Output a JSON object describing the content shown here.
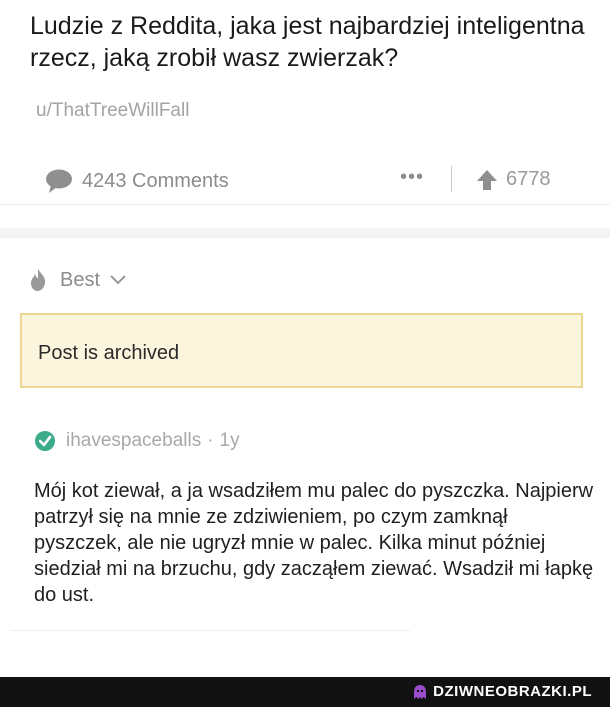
{
  "post": {
    "title": "Ludzie z Reddita, jaka jest najbardziej inteligentna rzecz, jaką zrobił wasz zwierzak?",
    "author": "u/ThatTreeWillFall"
  },
  "meta_bar": {
    "comments_label": "4243 Comments",
    "comments_icon": "speech-bubble-icon",
    "more_label": "•••",
    "score": "6778",
    "upvote_icon": "arrow-up-icon"
  },
  "sort": {
    "label": "Best",
    "icon": "flame-icon"
  },
  "notice": {
    "text": "Post is archived",
    "background": "#fcf5dd",
    "border": "#e9d792"
  },
  "comment": {
    "username": "ihavespaceballs",
    "separator": "·",
    "age": "1y",
    "verified_color": "#3bab8a",
    "body": "Mój kot ziewał, a ja wsadziłem mu palec do pyszczka. Najpierw patrzył się na mnie ze zdziwieniem, po czym zamknął pyszczek, ale nie ugryzł mnie w palec. Kilka minut później siedział mi na brzuchu, gdy zacząłem ziewać. Wsadził mi łapkę do ust."
  },
  "watermark": {
    "text": "DZIWNEOBRAZKI.PL",
    "icon_color": "#9b4dcc"
  }
}
